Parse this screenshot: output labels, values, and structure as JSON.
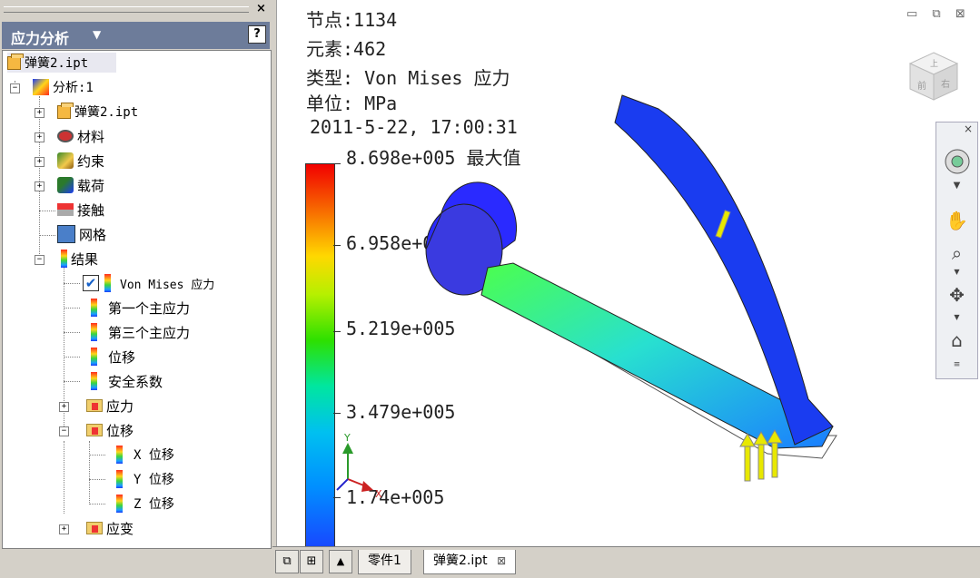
{
  "browser": {
    "title": "应力分析",
    "title_arrow": "▼",
    "close": "×",
    "help": "?",
    "tree": [
      {
        "label": "弹簧2.ipt",
        "icon": "part-icon"
      },
      {
        "label": "分析:1",
        "icon": "analysis-icon"
      },
      {
        "label": "弹簧2.ipt",
        "icon": "part-icon"
      },
      {
        "label": "材料",
        "icon": "material-icon"
      },
      {
        "label": "约束",
        "icon": "constraint-icon"
      },
      {
        "label": "载荷",
        "icon": "load-icon"
      },
      {
        "label": "接触",
        "icon": "contact-icon"
      },
      {
        "label": "网格",
        "icon": "mesh-icon"
      },
      {
        "label": "结果",
        "icon": "result-icon"
      },
      {
        "label": "Von Mises 应力",
        "icon": "result-bar-icon",
        "checked": true
      },
      {
        "label": "第一个主应力",
        "icon": "result-bar-icon"
      },
      {
        "label": "第三个主应力",
        "icon": "result-bar-icon"
      },
      {
        "label": "位移",
        "icon": "result-bar-icon"
      },
      {
        "label": "安全系数",
        "icon": "result-bar-icon"
      },
      {
        "label": "应力",
        "icon": "folder-icon"
      },
      {
        "label": "位移",
        "icon": "folder-icon"
      },
      {
        "label": "X 位移",
        "icon": "result-bar-icon"
      },
      {
        "label": "Y 位移",
        "icon": "result-bar-icon"
      },
      {
        "label": "Z 位移",
        "icon": "result-bar-icon"
      },
      {
        "label": "应变",
        "icon": "folder-icon"
      }
    ]
  },
  "viewport": {
    "nodes": "节点:1134",
    "elements": "元素:462",
    "type": "类型: Von Mises 应力",
    "unit": "单位: MPa",
    "timestamp": "2011-5-22, 17:00:31",
    "legend": {
      "max": "8.698e+005 最大值",
      "l2": "6.958e+005",
      "l3": "5.219e+005",
      "l4": "3.479e+005",
      "l5": "1.74e+005"
    },
    "triad": {
      "x": "X",
      "y": "Y"
    },
    "window_controls": "▭ ⧉ ⊠",
    "viewcube_faces": {
      "top": "上",
      "front": "前",
      "right": "右"
    }
  },
  "navbar": {
    "close": "×"
  },
  "tabs": {
    "items": [
      {
        "label": "零件1"
      },
      {
        "label": "弹簧2.ipt",
        "close": "⊠"
      }
    ]
  }
}
